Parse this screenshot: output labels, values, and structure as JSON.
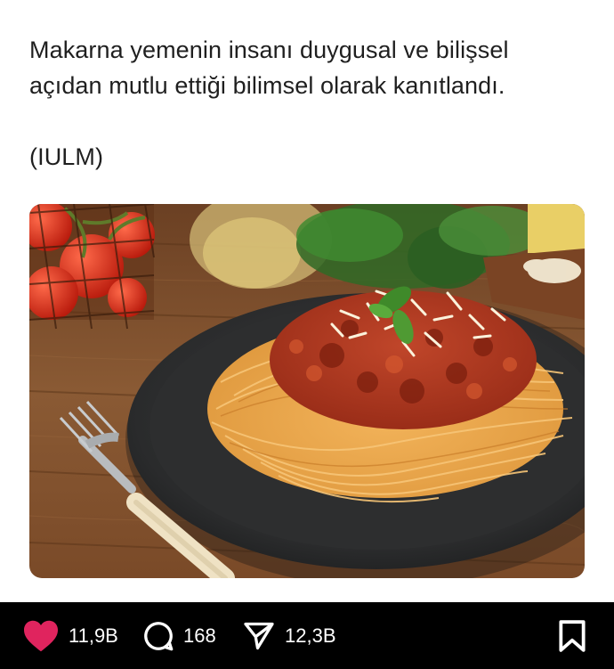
{
  "post": {
    "text": "Makarna yemenin insanı duygusal ve bilişsel\naçıdan mutlu ettiği bilimsel olarak kanıtlandı.\n\n(IULM)"
  },
  "actions": {
    "like_count": "11,9B",
    "reply_count": "168",
    "share_count": "12,3B"
  },
  "icons": {
    "like": "heart-icon",
    "reply": "speech-bubble-icon",
    "share": "send-icon",
    "bookmark": "bookmark-icon"
  },
  "colors": {
    "like_active": "#e0245e",
    "bar_background": "#000000",
    "text": "#1f1f1f"
  }
}
